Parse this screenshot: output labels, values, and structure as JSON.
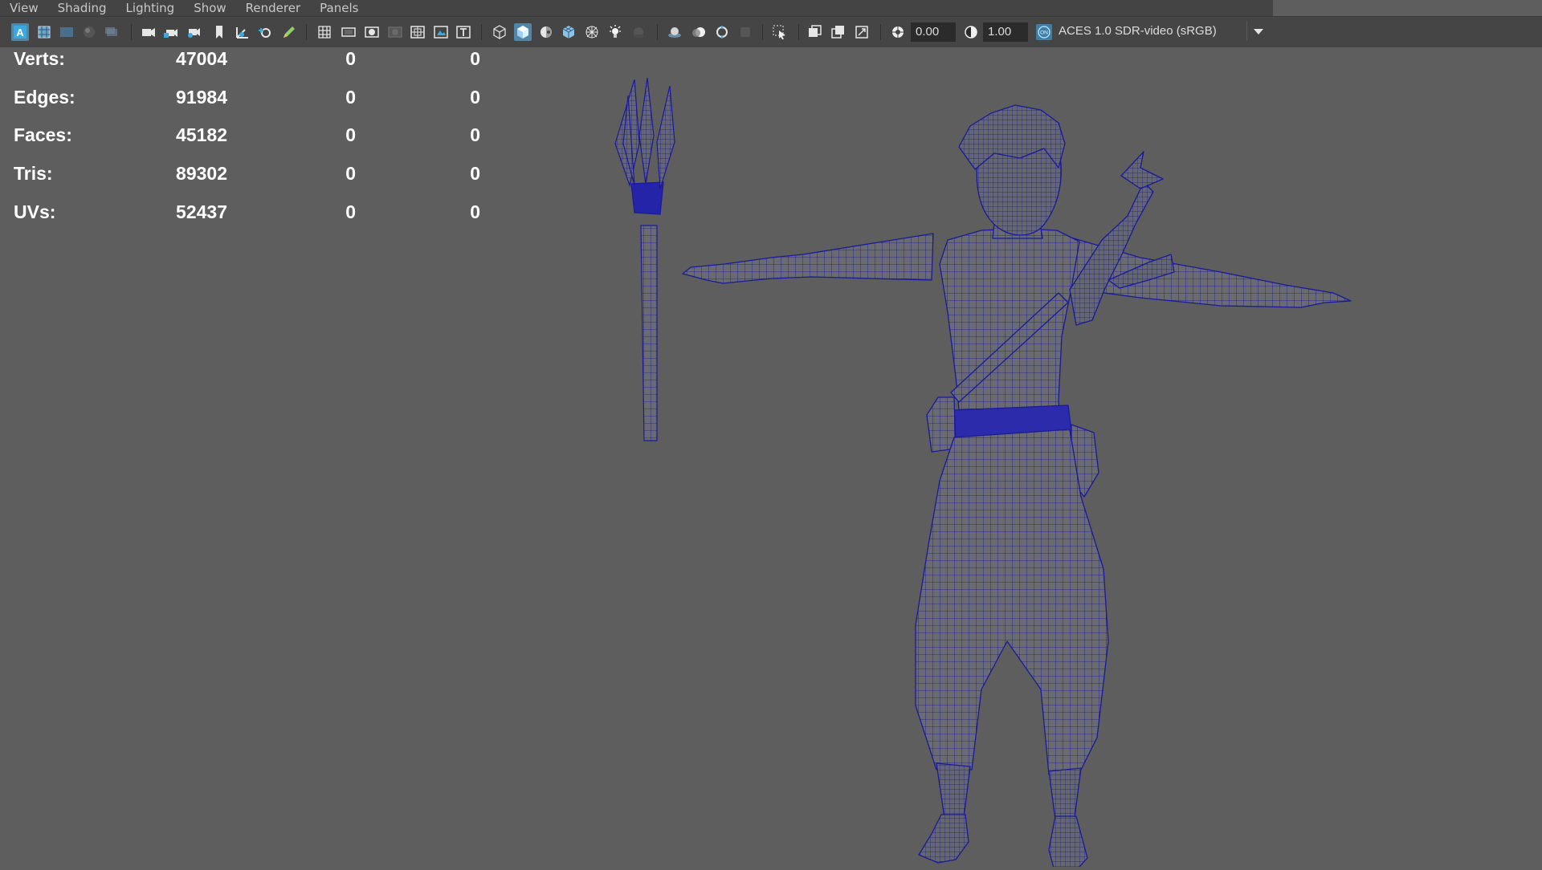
{
  "menu": {
    "items": [
      "View",
      "Shading",
      "Lighting",
      "Show",
      "Renderer",
      "Panels"
    ]
  },
  "toolbar": {
    "icons": [
      "select-camera-icon",
      "camera-attributes-icon",
      "bookmarks-icon",
      "image-plane-icon",
      "grease-pencil-icon",
      "camera-icon",
      "camera-lock-icon",
      "camera-pan-icon",
      "bookmark-icon",
      "2d-pan-icon",
      "camera-navigate-icon",
      "pencil-icon",
      "grid-icon",
      "film-gate-icon",
      "resolution-gate-icon",
      "gate-mask-icon",
      "field-chart-icon",
      "safe-action-icon",
      "safe-title-icon",
      "wireframe-icon",
      "smooth-shade-icon",
      "default-material-icon",
      "wireframe-on-shaded-icon",
      "xray-icon",
      "use-lights-icon",
      "shadows-icon",
      "screen-space-ao-icon",
      "motion-blur-icon",
      "anti-aliasing-icon",
      "depth-of-field-icon",
      "isolate-select-icon",
      "xray-joints-icon",
      "xray-active-icon",
      "backface-icon",
      "exposure-icon",
      "gamma-icon",
      "color-management-icon"
    ],
    "exposure_value": "0.00",
    "gamma_value": "1.00",
    "color_management_badge": "ON",
    "color_space": "ACES 1.0 SDR-video (sRGB)"
  },
  "hud": {
    "rows": [
      {
        "label": "Verts:",
        "value": "47004",
        "selected": "0",
        "components": "0"
      },
      {
        "label": "Edges:",
        "value": "91984",
        "selected": "0",
        "components": "0"
      },
      {
        "label": "Faces:",
        "value": "45182",
        "selected": "0",
        "components": "0"
      },
      {
        "label": "Tris:",
        "value": "89302",
        "selected": "0",
        "components": "0"
      },
      {
        "label": "UVs:",
        "value": "52437",
        "selected": "0",
        "components": "0"
      }
    ]
  },
  "colors": {
    "viewport_bg": "#5e5e5e",
    "toolbar_bg": "#454545",
    "menubar_bg": "#444444",
    "active_icon": "#5285a6",
    "wireframe": "#1a1a9a"
  }
}
